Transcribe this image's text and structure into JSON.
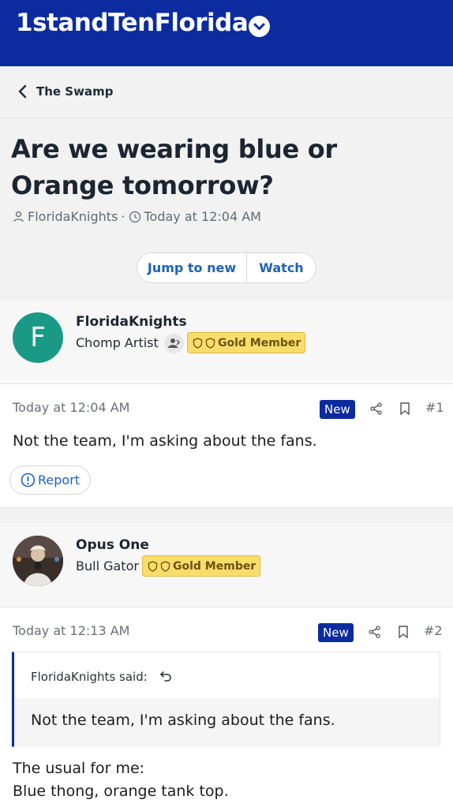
{
  "header": {
    "site_title": "1standTenFlorida"
  },
  "breadcrumb": {
    "label": "The Swamp"
  },
  "thread": {
    "title": "Are we wearing blue or Orange tomorrow?",
    "author": "FloridaKnights",
    "separator": "·",
    "time": "Today at 12:04 AM"
  },
  "actions": {
    "jump_label": "Jump to new",
    "watch_label": "Watch"
  },
  "posts": [
    {
      "avatar_letter": "F",
      "username": "FloridaKnights",
      "user_title": "Chomp Artist",
      "badge": "Gold Member",
      "date": "Today at 12:04 AM",
      "new_label": "New",
      "number": "#1",
      "body": "Not the team, I'm asking about the fans.",
      "report_label": "Report"
    },
    {
      "username": "Opus One",
      "user_title": "Bull Gator",
      "badge": "Gold Member",
      "date": "Today at 12:13 AM",
      "new_label": "New",
      "number": "#2",
      "quote_attribution": "FloridaKnights said:",
      "quote_text": "Not the team, I'm asking about the fans.",
      "body_line1": "The usual for me:",
      "body_line2": "Blue thong, orange tank top."
    }
  ],
  "colors": {
    "header_bg": "#0b2b9e",
    "link": "#1c63b7",
    "badge_gold": "#f9dd6b",
    "avatar_teal": "#1a9a86"
  }
}
